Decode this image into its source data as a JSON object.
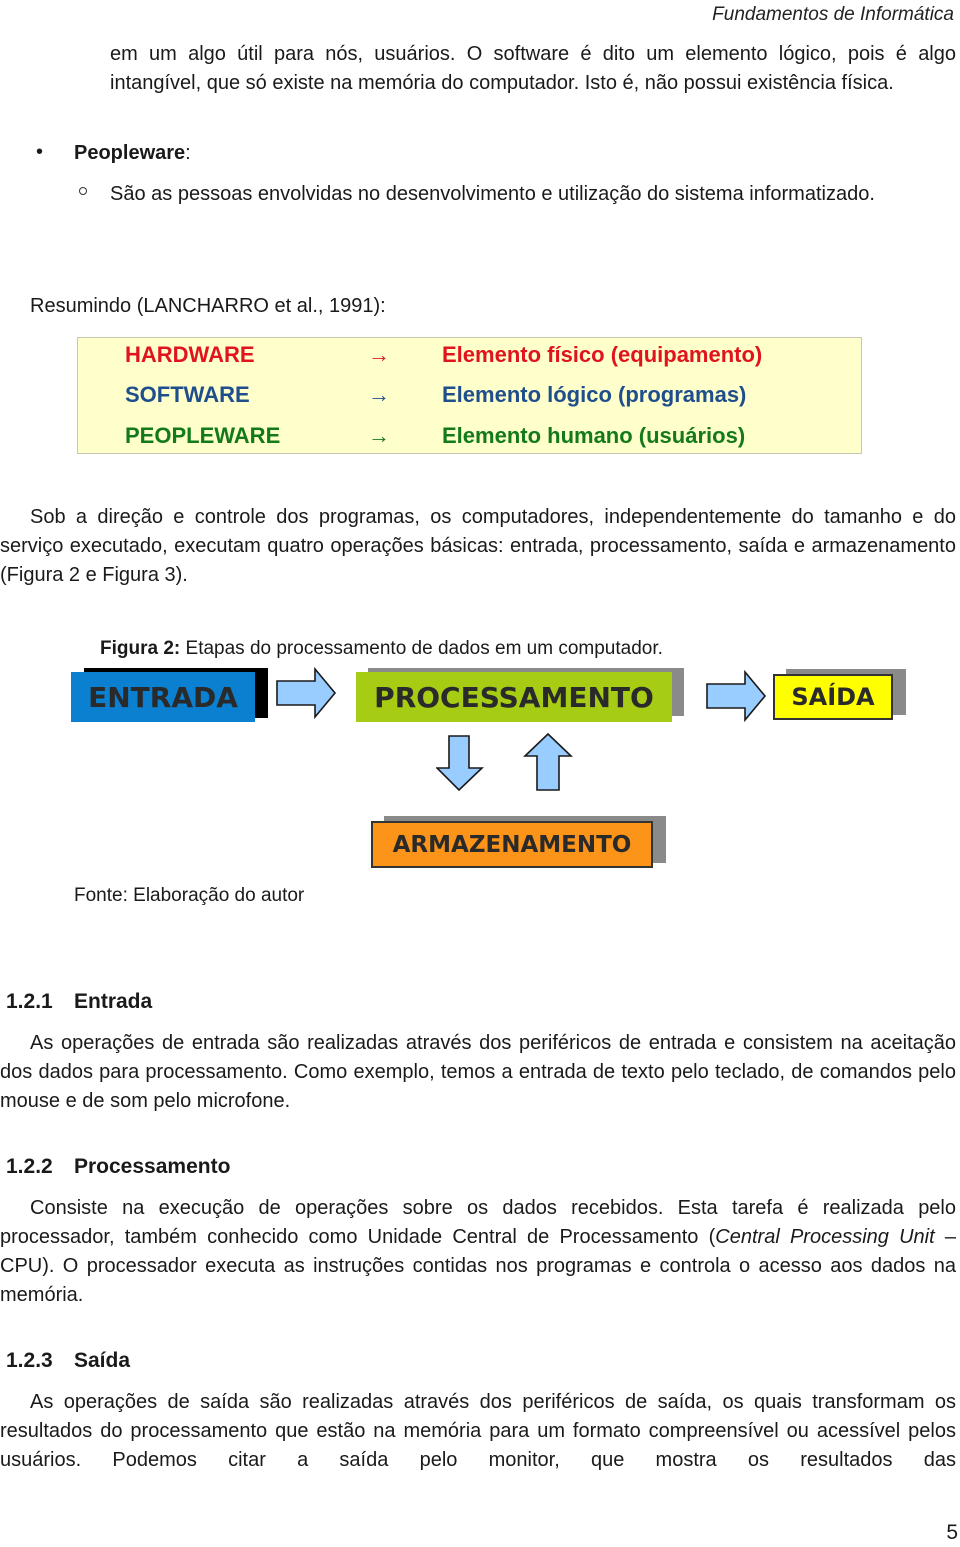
{
  "header": {
    "running_title": "Fundamentos de Informática"
  },
  "intro": {
    "continuation_paragraph": "em um algo útil para nós, usuários. O software é dito um elemento lógico, pois é algo intangível, que só existe na memória do computador. Isto é, não possui existência física.",
    "bullet": {
      "marker": "•",
      "term": "Peopleware",
      "suffix": ":"
    },
    "sub_bullet": "São as pessoas envolvidas no desenvolvimento e utilização do sistema informatizado."
  },
  "summary": {
    "lead": "Resumindo (LANCHARRO et al., 1991):",
    "rows": [
      {
        "term": "HARDWARE",
        "arrow": "→",
        "description": "Elemento físico (equipamento)",
        "color": "#e0141e"
      },
      {
        "term": "SOFTWARE",
        "arrow": "→",
        "description": "Elemento lógico (programas)",
        "color": "#1f4e8c"
      },
      {
        "term": "PEOPLEWARE",
        "arrow": "→",
        "description": "Elemento humano (usuários)",
        "color": "#137a1a"
      }
    ],
    "background": "#ffffcc"
  },
  "paragraph_operations": "Sob a direção e controle dos programas, os computadores, independentemente do tamanho e do serviço executado, executam quatro operações básicas: entrada, processamento, saída e armazenamento (Figura 2 e Figura 3).",
  "figure": {
    "label": "Figura 2:",
    "caption": "Etapas do processamento de dados em um computador.",
    "stages": {
      "entrada": {
        "label": "ENTRADA",
        "color": "#0b7fd0"
      },
      "processamento": {
        "label": "PROCESSAMENTO",
        "color": "#a6cc13"
      },
      "saida": {
        "label": "SAÍDA",
        "color": "#ffff00"
      },
      "armazenamento": {
        "label": "ARMAZENAMENTO",
        "color": "#fb9418"
      }
    },
    "arrow_color": "#99ccff",
    "source": "Fonte: Elaboração do autor"
  },
  "sections": [
    {
      "number": "1.2.1",
      "title": "Entrada",
      "body": [
        {
          "text": "As operações de entrada são realizadas através dos periféricos de entrada e consistem na aceitação dos dados para processamento. Como exemplo, temos a entrada de texto pelo teclado, de comandos pelo mouse e de som pelo microfone."
        }
      ]
    },
    {
      "number": "1.2.2",
      "title": "Processamento",
      "body_before_italic": "Consiste na execução de operações sobre os dados recebidos. Esta tarefa é realizada pelo processador, também conhecido como Unidade Central de Processamento (",
      "italic": "Central Processing Unit",
      "body_after_italic": " – CPU). O processador executa as instruções contidas nos programas e controla o acesso aos dados na memória."
    },
    {
      "number": "1.2.3",
      "title": "Saída",
      "body": [
        {
          "text": "As operações de saída são realizadas através dos periféricos de saída, os quais transformam os resultados do processamento que estão na memória para um formato compreensível ou acessível pelos usuários. Podemos citar a saída pelo monitor, que mostra os resultados das"
        }
      ]
    }
  ],
  "footer": {
    "page_number": "5"
  }
}
